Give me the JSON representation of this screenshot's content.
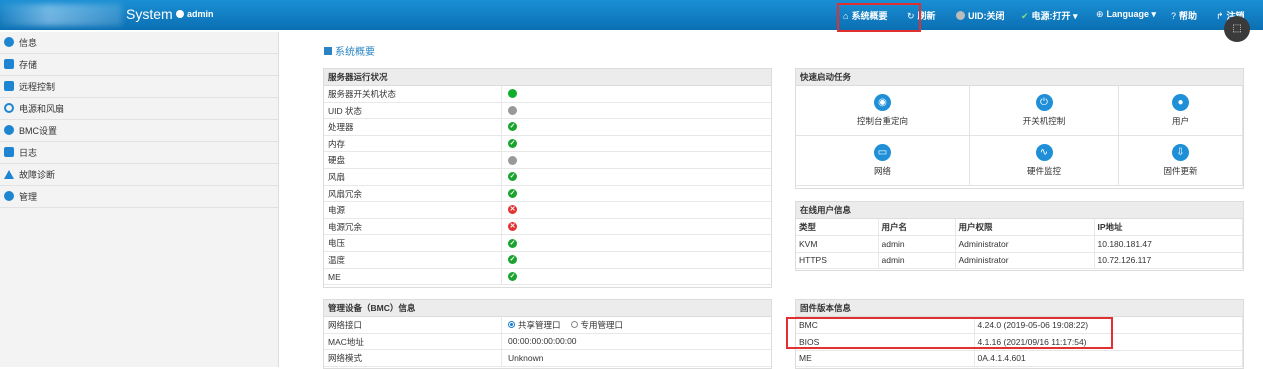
{
  "header": {
    "brand": "System",
    "user": "admin",
    "nav": [
      {
        "label": "系统概要",
        "icon": "home-icon"
      },
      {
        "label": "刷新",
        "icon": "refresh-icon"
      },
      {
        "label": "UID:关闭",
        "icon": "uid-dot-icon"
      },
      {
        "label": "电源:打开 ▾",
        "icon": "check-icon"
      },
      {
        "label": "Language ▾",
        "icon": "globe-icon"
      },
      {
        "label": "帮助",
        "icon": "help-icon"
      },
      {
        "label": "注销",
        "icon": "logout-icon"
      }
    ]
  },
  "sidebar": {
    "items": [
      {
        "label": "信息",
        "color": "#1e86d0"
      },
      {
        "label": "存储",
        "color": "#1e86d0"
      },
      {
        "label": "远程控制",
        "color": "#1e86d0"
      },
      {
        "label": "电源和风扇",
        "color": "#1e86d0"
      },
      {
        "label": "BMC设置",
        "color": "#1e86d0"
      },
      {
        "label": "日志",
        "color": "#1e86d0"
      },
      {
        "label": "故障诊断",
        "color": "#1e86d0"
      },
      {
        "label": "管理",
        "color": "#1e86d0"
      }
    ]
  },
  "breadcrumb": "系统概要",
  "server_status": {
    "title": "服务器运行状况",
    "rows": [
      {
        "label": "服务器开关机状态",
        "status": "on"
      },
      {
        "label": "UID 状态",
        "status": "gray"
      },
      {
        "label": "处理器",
        "status": "ok"
      },
      {
        "label": "内存",
        "status": "ok"
      },
      {
        "label": "硬盘",
        "status": "gray"
      },
      {
        "label": "风扇",
        "status": "ok"
      },
      {
        "label": "风扇冗余",
        "status": "ok"
      },
      {
        "label": "电源",
        "status": "err"
      },
      {
        "label": "电源冗余",
        "status": "err"
      },
      {
        "label": "电压",
        "status": "ok"
      },
      {
        "label": "温度",
        "status": "ok"
      },
      {
        "label": "ME",
        "status": "ok"
      }
    ]
  },
  "quick_tasks": {
    "title": "快速启动任务",
    "items": [
      {
        "label": "控制台重定向",
        "icon": "console-icon"
      },
      {
        "label": "开关机控制",
        "icon": "power-icon"
      },
      {
        "label": "用户",
        "icon": "user-icon"
      },
      {
        "label": "网络",
        "icon": "network-icon"
      },
      {
        "label": "硬件监控",
        "icon": "monitor-icon"
      },
      {
        "label": "固件更新",
        "icon": "update-icon"
      }
    ]
  },
  "online_users": {
    "title": "在线用户信息",
    "columns": [
      "类型",
      "用户名",
      "用户权限",
      "IP地址"
    ],
    "rows": [
      [
        "KVM",
        "admin",
        "Administrator",
        "10.180.181.47"
      ],
      [
        "HTTPS",
        "admin",
        "Administrator",
        "10.72.126.117"
      ]
    ]
  },
  "bmc_info": {
    "title": "管理设备（BMC）信息",
    "rows": [
      {
        "label": "网络接口",
        "options": [
          "共享管理口",
          "专用管理口"
        ],
        "selected": 0
      },
      {
        "label": "MAC地址",
        "value": "00:00:00:00:00:00"
      },
      {
        "label": "网络模式",
        "value": "Unknown"
      }
    ]
  },
  "firmware": {
    "title": "固件版本信息",
    "rows": [
      [
        "BMC",
        "4.24.0 (2019-05-06 19:08:22)"
      ],
      [
        "BIOS",
        "4.1.16 (2021/09/16 11:17:54)"
      ],
      [
        "ME",
        "0A.4.1.4.601"
      ]
    ]
  },
  "colors": {
    "accent": "#1a8fd4",
    "highlight": "#e03030"
  }
}
